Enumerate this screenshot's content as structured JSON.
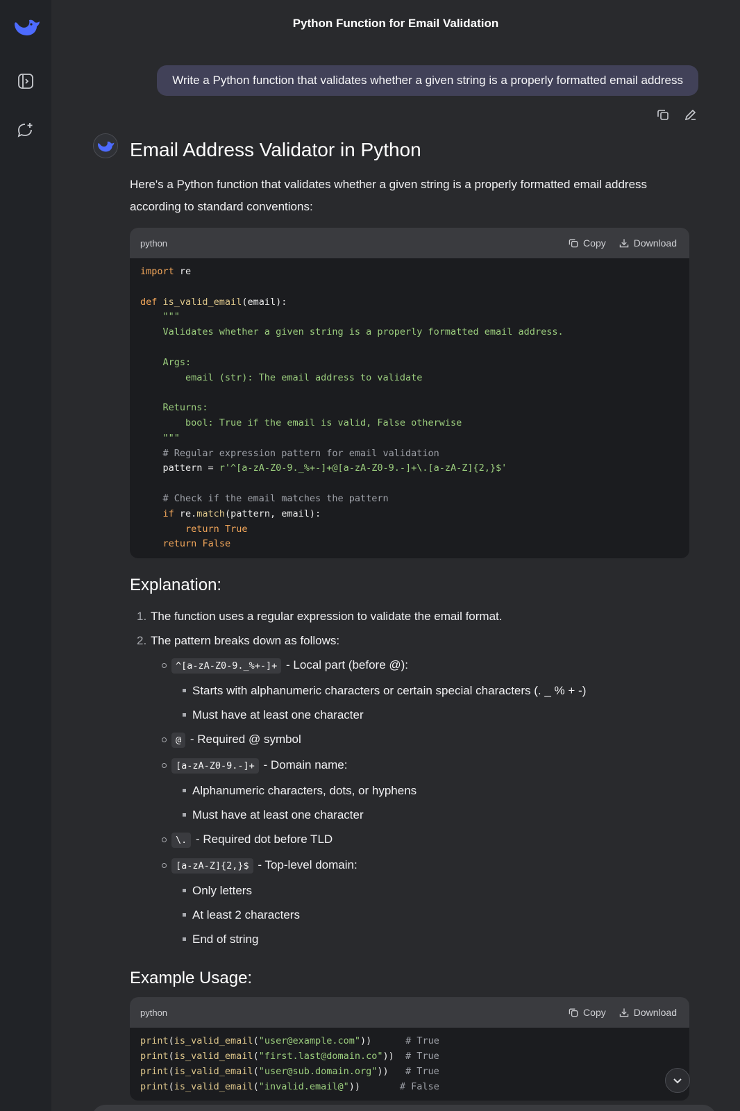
{
  "sidebar": {
    "logo_icon": "deepseek-whale-icon",
    "toggle_icon": "sidebar-toggle-icon",
    "new_chat_icon": "new-chat-icon"
  },
  "chat": {
    "title": "Python Function for Email Validation",
    "user_message": "Write a Python function that validates whether a given string is a properly formatted email address",
    "user_actions": [
      "copy-icon",
      "edit-icon"
    ]
  },
  "answer": {
    "heading": "Email Address Validator in Python",
    "intro": "Here's a Python function that validates whether a given string is a properly formatted email address according to standard conventions:",
    "code1": {
      "lang": "python",
      "copy_label": "Copy",
      "download_label": "Download",
      "lines": [
        "import re",
        "",
        "def is_valid_email(email):",
        "    \"\"\"",
        "    Validates whether a given string is a properly formatted email address.",
        "",
        "    Args:",
        "        email (str): The email address to validate",
        "",
        "    Returns:",
        "        bool: True if the email is valid, False otherwise",
        "    \"\"\"",
        "    # Regular expression pattern for email validation",
        "    pattern = r'^[a-zA-Z0-9._%+-]+@[a-zA-Z0-9.-]+\\.[a-zA-Z]{2,}$'",
        "",
        "    # Check if the email matches the pattern",
        "    if re.match(pattern, email):",
        "        return True",
        "    return False"
      ]
    },
    "explanation_heading": "Explanation:",
    "explanation": {
      "item1": "The function uses a regular expression to validate the email format.",
      "item2": "The pattern breaks down as follows:",
      "parts": [
        {
          "code": "^[a-zA-Z0-9._%+-]+",
          "desc": "- Local part (before @):",
          "subs": [
            "Starts with alphanumeric characters or certain special characters (. _ % + -)",
            "Must have at least one character"
          ]
        },
        {
          "code": "@",
          "desc": "- Required @ symbol",
          "subs": []
        },
        {
          "code": "[a-zA-Z0-9.-]+",
          "desc": "- Domain name:",
          "subs": [
            "Alphanumeric characters, dots, or hyphens",
            "Must have at least one character"
          ]
        },
        {
          "code": "\\.",
          "desc": "- Required dot before TLD",
          "subs": []
        },
        {
          "code": "[a-zA-Z]{2,}$",
          "desc": "- Top-level domain:",
          "subs": [
            "Only letters",
            "At least 2 characters",
            "End of string"
          ]
        }
      ]
    },
    "example_heading": "Example Usage:",
    "code2": {
      "lang": "python",
      "copy_label": "Copy",
      "download_label": "Download",
      "lines": [
        {
          "arg": "\"user@example.com\"",
          "pad": "      ",
          "comment": "# True"
        },
        {
          "arg": "\"first.last@domain.co\"",
          "pad": "  ",
          "comment": "# True"
        },
        {
          "arg": "\"user@sub.domain.org\"",
          "pad": "   ",
          "comment": "# True"
        },
        {
          "arg": "\"invalid.email@\"",
          "pad": "       ",
          "comment": "# False"
        }
      ]
    }
  }
}
